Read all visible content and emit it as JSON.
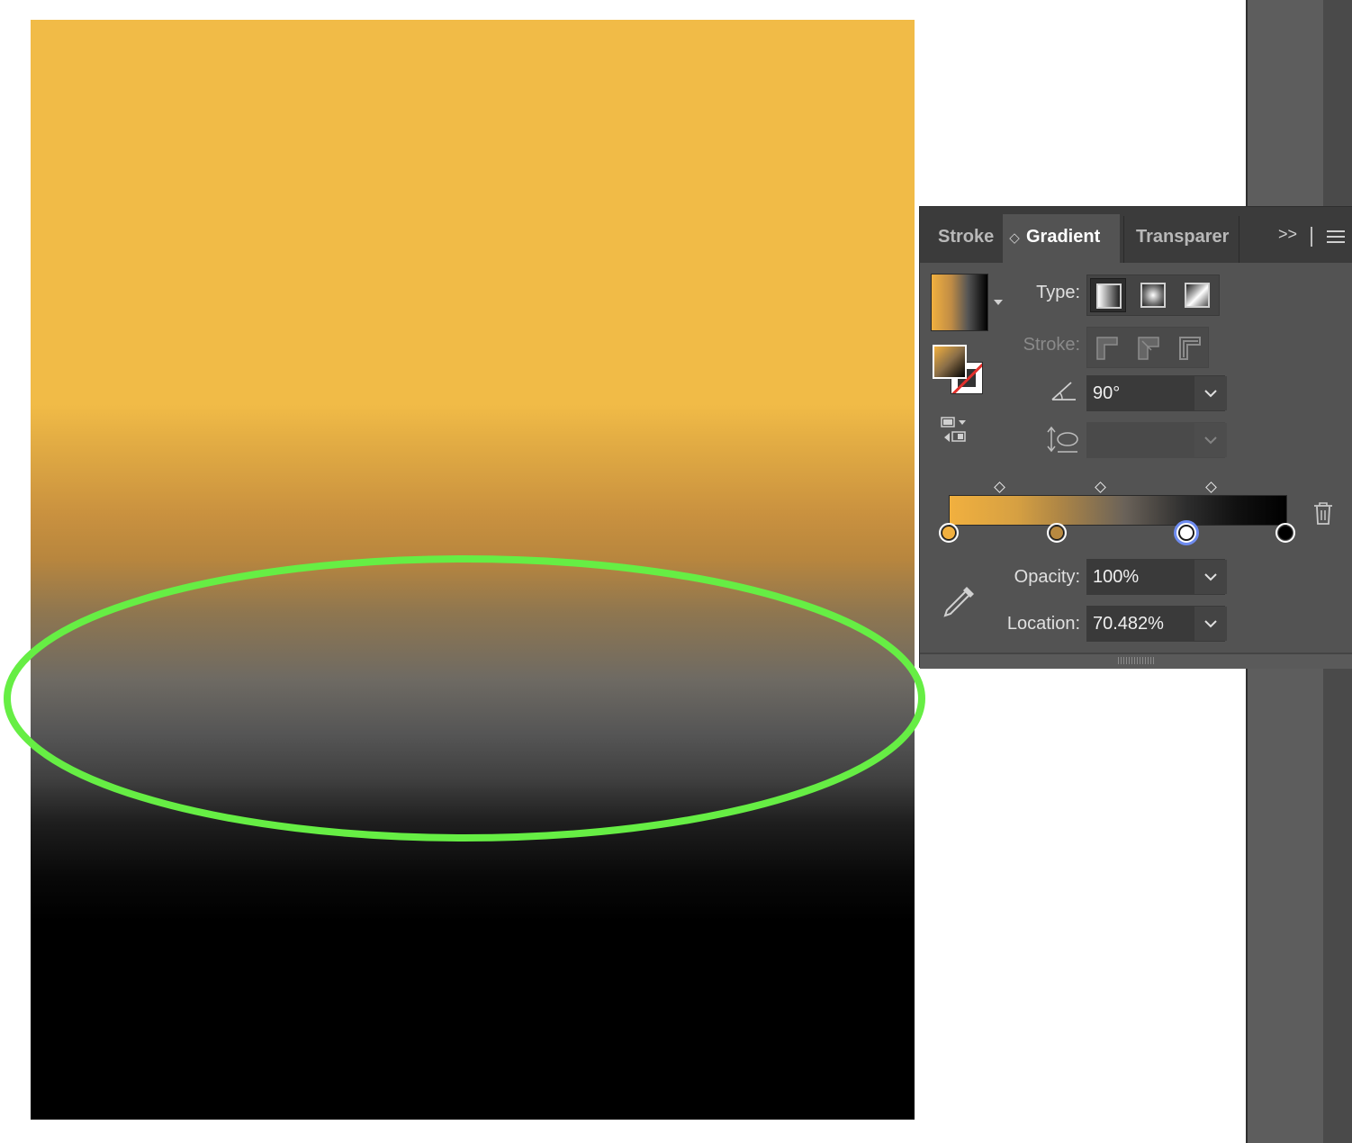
{
  "panel": {
    "tabs": [
      {
        "label": "Stroke",
        "active": false
      },
      {
        "label": "Gradient",
        "active": true
      },
      {
        "label": "Transparer",
        "active": false
      }
    ],
    "more_label": ">>",
    "type_label": "Type:",
    "stroke_label": "Stroke:",
    "angle_value": "90°",
    "aspect_value": "",
    "opacity_label": "Opacity:",
    "opacity_value": "100%",
    "location_label": "Location:",
    "location_value": "70.482%",
    "gradient_type_selected": "linear",
    "gradient_stops": [
      {
        "location_pct": 0,
        "color": "#f1b03f"
      },
      {
        "location_pct": 32,
        "color": "#b88940"
      },
      {
        "location_pct": 70.482,
        "color": "#ffffff",
        "selected": true
      },
      {
        "location_pct": 100,
        "color": "#000000"
      }
    ],
    "midpoints_pct": [
      15,
      45,
      78
    ]
  },
  "artboard": {
    "gradient_colors": [
      "#f1bb47",
      "#b8863e",
      "#555555",
      "#000000"
    ],
    "highlight_color": "#66ee44"
  },
  "icons": {
    "angle": "angle-icon",
    "aspect": "aspect-ratio-icon",
    "delete": "trash-icon",
    "eyedropper": "eyedropper-icon",
    "reverse": "reverse-gradient-icon",
    "menu": "hamburger-icon"
  }
}
